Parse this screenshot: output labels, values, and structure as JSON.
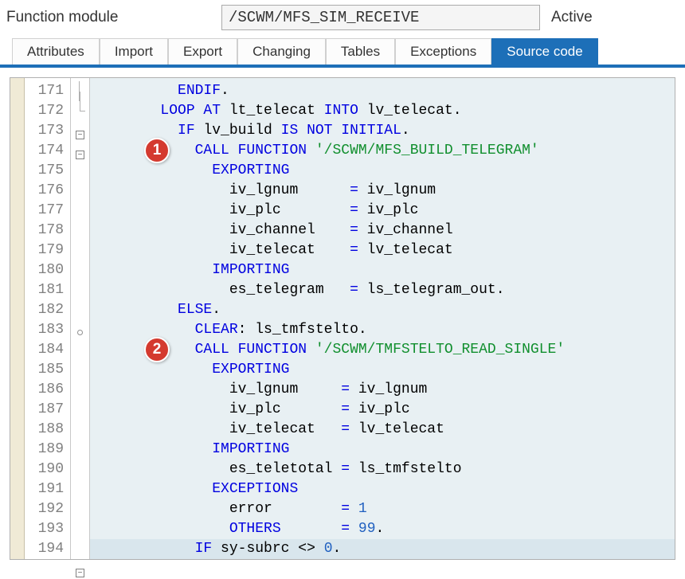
{
  "header": {
    "label": "Function module",
    "value": "/SCWM/MFS_SIM_RECEIVE",
    "status": "Active"
  },
  "tabs": [
    {
      "label": "Attributes",
      "active": false
    },
    {
      "label": "Import",
      "active": false
    },
    {
      "label": "Export",
      "active": false
    },
    {
      "label": "Changing",
      "active": false
    },
    {
      "label": "Tables",
      "active": false
    },
    {
      "label": "Exceptions",
      "active": false
    },
    {
      "label": "Source code",
      "active": true
    }
  ],
  "callouts": [
    {
      "num": "1",
      "line": 174
    },
    {
      "num": "2",
      "line": 184
    }
  ],
  "code": {
    "first_line": 171,
    "lines": [
      {
        "n": 171,
        "fold": "end",
        "seg": [
          [
            "",
            ""
          ],
          [
            "kw",
            "ENDIF"
          ],
          [
            "",
            "."
          ]
        ],
        "ind": 10
      },
      {
        "n": 172,
        "fold": "minus",
        "seg": [
          [
            "kw",
            "LOOP AT"
          ],
          [
            "",
            " lt_telecat "
          ],
          [
            "kw",
            "INTO"
          ],
          [
            "",
            " lv_telecat."
          ]
        ],
        "ind": 8
      },
      {
        "n": 173,
        "fold": "minus",
        "seg": [
          [
            "kw",
            "IF"
          ],
          [
            "",
            " lv_build "
          ],
          [
            "kw",
            "IS NOT INITIAL"
          ],
          [
            "",
            "."
          ]
        ],
        "ind": 10
      },
      {
        "n": 174,
        "fold": "line",
        "seg": [
          [
            "kw",
            "CALL FUNCTION"
          ],
          [
            "",
            " "
          ],
          [
            "str",
            "'/SCWM/MFS_BUILD_TELEGRAM'"
          ]
        ],
        "ind": 12
      },
      {
        "n": 175,
        "fold": "line",
        "seg": [
          [
            "kw",
            "EXPORTING"
          ]
        ],
        "ind": 14
      },
      {
        "n": 176,
        "fold": "line",
        "seg": [
          [
            "",
            "iv_lgnum      "
          ],
          [
            "kw",
            "="
          ],
          [
            "",
            " iv_lgnum"
          ]
        ],
        "ind": 16
      },
      {
        "n": 177,
        "fold": "line",
        "seg": [
          [
            "",
            "iv_plc        "
          ],
          [
            "kw",
            "="
          ],
          [
            "",
            " iv_plc"
          ]
        ],
        "ind": 16
      },
      {
        "n": 178,
        "fold": "line",
        "seg": [
          [
            "",
            "iv_channel    "
          ],
          [
            "kw",
            "="
          ],
          [
            "",
            " iv_channel"
          ]
        ],
        "ind": 16
      },
      {
        "n": 179,
        "fold": "line",
        "seg": [
          [
            "",
            "iv_telecat    "
          ],
          [
            "kw",
            "="
          ],
          [
            "",
            " lv_telecat"
          ]
        ],
        "ind": 16
      },
      {
        "n": 180,
        "fold": "line",
        "seg": [
          [
            "kw",
            "IMPORTING"
          ]
        ],
        "ind": 14
      },
      {
        "n": 181,
        "fold": "line",
        "seg": [
          [
            "",
            "es_telegram   "
          ],
          [
            "kw",
            "="
          ],
          [
            "",
            " ls_telegram_out."
          ]
        ],
        "ind": 16
      },
      {
        "n": 182,
        "fold": "circle",
        "seg": [
          [
            "kw",
            "ELSE"
          ],
          [
            "",
            "."
          ]
        ],
        "ind": 10
      },
      {
        "n": 183,
        "fold": "line",
        "seg": [
          [
            "kw",
            "CLEAR"
          ],
          [
            "",
            ": ls_tmfstelto."
          ]
        ],
        "ind": 12
      },
      {
        "n": 184,
        "fold": "line",
        "seg": [
          [
            "kw",
            "CALL FUNCTION"
          ],
          [
            "",
            " "
          ],
          [
            "str",
            "'/SCWM/TMFSTELTO_READ_SINGLE'"
          ]
        ],
        "ind": 12
      },
      {
        "n": 185,
        "fold": "line",
        "seg": [
          [
            "kw",
            "EXPORTING"
          ]
        ],
        "ind": 14
      },
      {
        "n": 186,
        "fold": "line",
        "seg": [
          [
            "",
            "iv_lgnum     "
          ],
          [
            "kw",
            "="
          ],
          [
            "",
            " iv_lgnum"
          ]
        ],
        "ind": 16
      },
      {
        "n": 187,
        "fold": "line",
        "seg": [
          [
            "",
            "iv_plc       "
          ],
          [
            "kw",
            "="
          ],
          [
            "",
            " iv_plc"
          ]
        ],
        "ind": 16
      },
      {
        "n": 188,
        "fold": "line",
        "seg": [
          [
            "",
            "iv_telecat   "
          ],
          [
            "kw",
            "="
          ],
          [
            "",
            " lv_telecat"
          ]
        ],
        "ind": 16
      },
      {
        "n": 189,
        "fold": "line",
        "seg": [
          [
            "kw",
            "IMPORTING"
          ]
        ],
        "ind": 14
      },
      {
        "n": 190,
        "fold": "line",
        "seg": [
          [
            "",
            "es_teletotal "
          ],
          [
            "kw",
            "="
          ],
          [
            "",
            " ls_tmfstelto"
          ]
        ],
        "ind": 16
      },
      {
        "n": 191,
        "fold": "line",
        "seg": [
          [
            "kw",
            "EXCEPTIONS"
          ]
        ],
        "ind": 14
      },
      {
        "n": 192,
        "fold": "line",
        "seg": [
          [
            "",
            "error        "
          ],
          [
            "kw",
            "="
          ],
          [
            "",
            " "
          ],
          [
            "num",
            "1"
          ]
        ],
        "ind": 16
      },
      {
        "n": 193,
        "fold": "line",
        "seg": [
          [
            "kw",
            "OTHERS"
          ],
          [
            "",
            "       "
          ],
          [
            "kw",
            "="
          ],
          [
            "",
            " "
          ],
          [
            "num",
            "99"
          ],
          [
            "",
            "."
          ]
        ],
        "ind": 16
      },
      {
        "n": 194,
        "fold": "minus",
        "seg": [
          [
            "kw",
            "IF"
          ],
          [
            "",
            " sy"
          ],
          [
            "op",
            "-"
          ],
          [
            "",
            "subrc "
          ],
          [
            "op",
            "<>"
          ],
          [
            "",
            " "
          ],
          [
            "num",
            "0"
          ],
          [
            "",
            "."
          ]
        ],
        "ind": 12,
        "hl": true
      }
    ]
  }
}
